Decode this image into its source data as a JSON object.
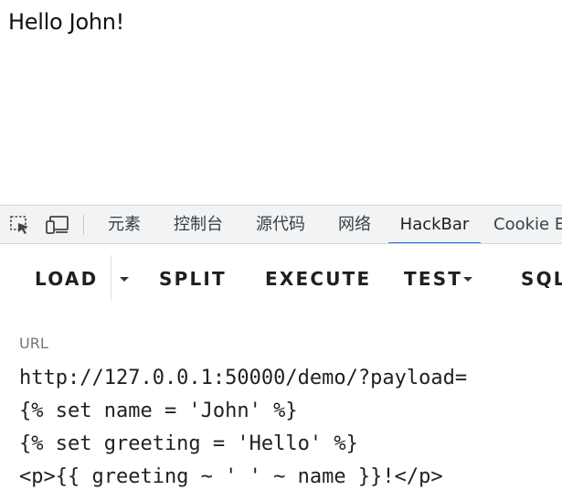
{
  "page": {
    "greeting": "Hello John!"
  },
  "devtools": {
    "icons": {
      "inspect": "inspect-element-icon",
      "device": "device-toggle-icon"
    },
    "tabs": [
      {
        "label": "元素"
      },
      {
        "label": "控制台"
      },
      {
        "label": "源代码"
      },
      {
        "label": "网络"
      },
      {
        "label": "HackBar",
        "active": true
      },
      {
        "label": "Cookie Ed"
      }
    ],
    "accent_color": "#1a73e8"
  },
  "hackbar": {
    "buttons": {
      "load": "LOAD",
      "split": "SPLIT",
      "execute": "EXECUTE",
      "test": "TEST",
      "sql": "SQL"
    },
    "url_label": "URL",
    "url_lines": [
      "http://127.0.0.1:50000/demo/?payload=",
      "{% set name = 'John' %}",
      "{% set greeting = 'Hello' %}",
      "<p>{{ greeting ~ ' ' ~ name }}!</p>"
    ]
  }
}
